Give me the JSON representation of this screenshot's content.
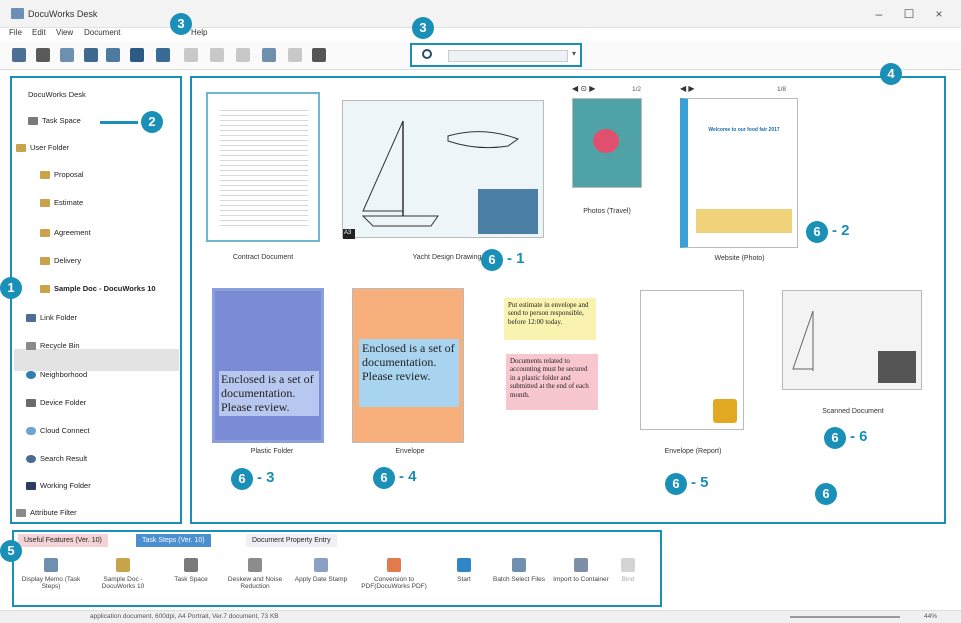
{
  "window": {
    "title": "DocuWorks Desk"
  },
  "menu": [
    "File",
    "Edit",
    "View",
    "Document",
    "Help"
  ],
  "tree": {
    "desk": "DocuWorks Desk",
    "task_space": "Task Space",
    "user_folder": "User Folder",
    "subfolders": [
      "Proposal",
      "Estimate",
      "Agreement",
      "Delivery"
    ],
    "sample": "Sample Doc - DocuWorks 10",
    "others": [
      "Link Folder",
      "Recycle Bin",
      "Neighborhood",
      "Device Folder",
      "Cloud Connect",
      "Search Result",
      "Working Folder",
      "Attribute Filter"
    ]
  },
  "documents": {
    "contract": "Contract Document",
    "yacht": "Yacht Design Drawing",
    "photos": "Photos (Travel)",
    "website": "Website (Photo)",
    "plastic": "Plastic Folder",
    "envelope": "Envelope",
    "envelope_report": "Envelope (Report)",
    "scanned": "Scanned Document",
    "photos_page": "1/2",
    "website_page": "1/8",
    "a3_tag": "A3",
    "envelope_text": "Enclosed is a set of documentation. Please review.",
    "sticky_yellow": "Put estimate in envelope and send to person responsible, before 12:00 today.",
    "sticky_pink": "Documents related to accounting must be secured in a plastic folder and submitted at the end of each month.",
    "website_heading": "Welcome to our food fair 2017"
  },
  "bottom": {
    "tabs": [
      "Useful Features (Ver. 10)",
      "Task Steps (Ver. 10)",
      "Document Property Entry"
    ],
    "tools": [
      "Display Memo (Task Steps)",
      "Sample Doc - DocuWorks 10",
      "Task Space",
      "Deskew and Noise Reduction",
      "Apply Date Stamp",
      "Conversion to PDF(DocuWorks PDF)",
      "Start",
      "Batch Select Files",
      "Import to Container",
      "Bind"
    ]
  },
  "status": {
    "text": "application document, 600dpi, A4 Portrait, Ver.7 document, 73 KB",
    "zoom": "44%"
  },
  "annotations": {
    "b1": "1",
    "b2": "2",
    "b3": "3",
    "b4": "4",
    "b5": "5",
    "b6": "6",
    "l61": "- 1",
    "l62": "- 2",
    "l63": "- 3",
    "l64": "- 4",
    "l65": "- 5",
    "l66": "- 6"
  }
}
